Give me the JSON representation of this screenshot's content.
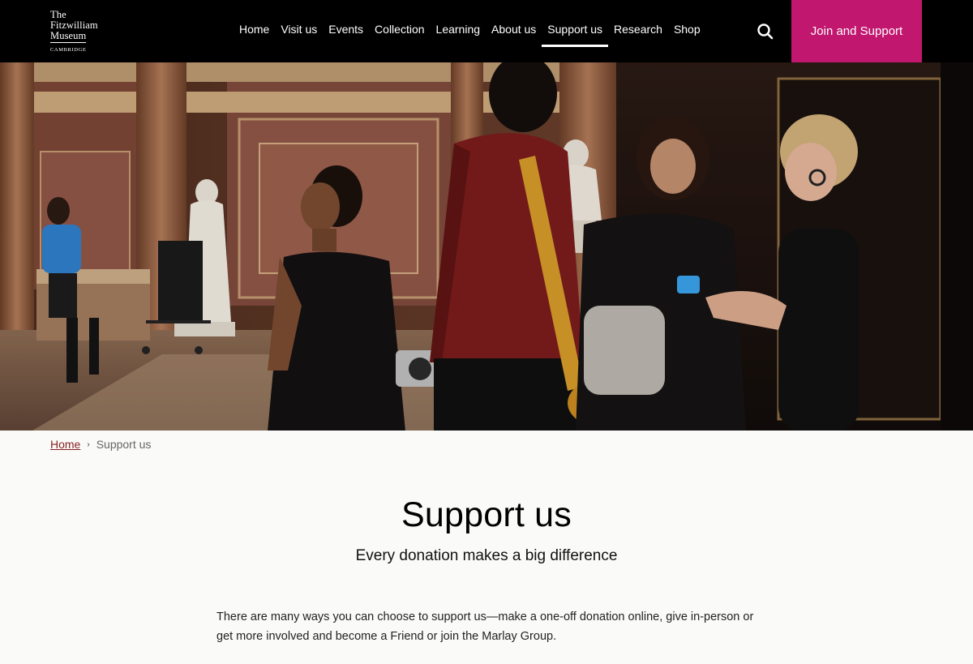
{
  "logo": {
    "line1": "The",
    "line2": "Fitzwilliam",
    "line3": "Museum",
    "line4": "CAMBRIDGE"
  },
  "nav": {
    "items": [
      {
        "label": "Home"
      },
      {
        "label": "Visit us"
      },
      {
        "label": "Events"
      },
      {
        "label": "Collection"
      },
      {
        "label": "Learning"
      },
      {
        "label": "About us"
      },
      {
        "label": "Support us"
      },
      {
        "label": "Research"
      },
      {
        "label": "Shop"
      }
    ],
    "active": "Support us",
    "search_icon": "search-icon",
    "join_label": "Join and Support"
  },
  "hero": {
    "icon": "photo"
  },
  "breadcrumb": {
    "home": "Home",
    "separator": "›",
    "current": "Support us"
  },
  "main": {
    "title": "Support us",
    "subtitle": "Every donation makes a big difference",
    "intro": "There are many ways you can choose to support us—make a one-off donation online, give in-person or get more involved and become a Friend or join the Marlay Group."
  },
  "colors": {
    "header_bg": "#000000",
    "accent": "#c2176f",
    "link": "#8a1f1f",
    "page_bg": "#fafaf9"
  }
}
